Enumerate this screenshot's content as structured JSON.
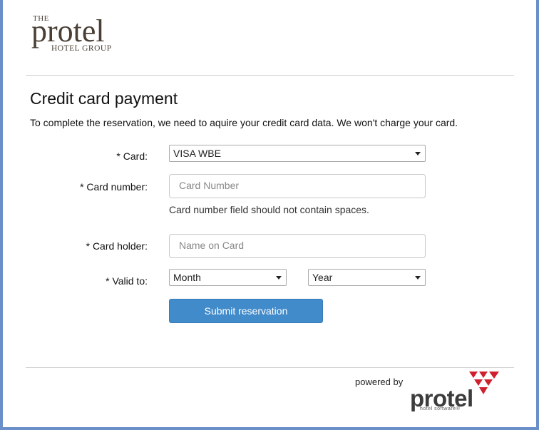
{
  "logo": {
    "the": "THE",
    "brand": "protel",
    "group": "HOTEL GROUP"
  },
  "page": {
    "title": "Credit card payment",
    "intro": "To complete the reservation, we need to aquire your credit card data. We won't charge your card."
  },
  "form": {
    "card_label": "* Card:",
    "card_value": "VISA WBE",
    "card_number_label": "* Card number:",
    "card_number_placeholder": "Card Number",
    "card_number_hint": "Card number field should not contain spaces.",
    "card_holder_label": "* Card holder:",
    "card_holder_placeholder": "Name on Card",
    "valid_to_label": "* Valid to:",
    "month_value": "Month",
    "year_value": "Year",
    "submit_label": "Submit reservation"
  },
  "footer": {
    "powered_by": "powered by",
    "brand": "protel",
    "tagline": "hotel software®"
  },
  "colors": {
    "accent": "#428bca",
    "frame": "#6b8fc9",
    "brand_red": "#d0202e"
  }
}
